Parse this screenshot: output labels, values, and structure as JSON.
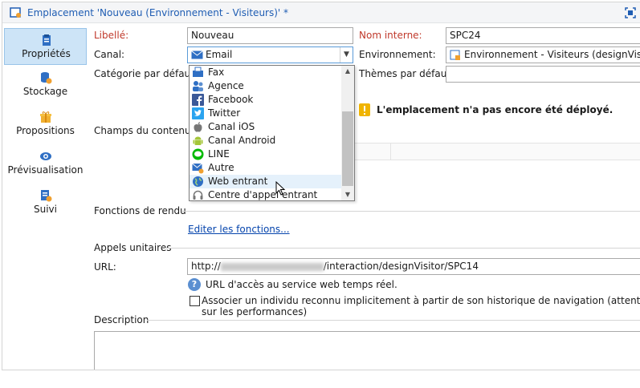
{
  "window": {
    "title": "Emplacement 'Nouveau (Environnement - Visiteurs)' *"
  },
  "sidebar": {
    "items": [
      {
        "label": "Propriétés",
        "icon": "clipboard-icon",
        "active": true
      },
      {
        "label": "Stockage",
        "icon": "database-icon",
        "active": false
      },
      {
        "label": "Propositions",
        "icon": "gift-icon",
        "active": false
      },
      {
        "label": "Prévisualisation",
        "icon": "eye-icon",
        "active": false
      },
      {
        "label": "Suivi",
        "icon": "report-icon",
        "active": false
      }
    ]
  },
  "form": {
    "libelle_label": "Libellé:",
    "libelle_value": "Nouveau",
    "nom_interne_label": "Nom interne:",
    "nom_interne_value": "SPC24",
    "canal_label": "Canal:",
    "canal_value": "Email",
    "environnement_label": "Environnement:",
    "environnement_value": "Environnement - Visiteurs (designVisitor)",
    "categorie_label": "Catégorie par défaut:",
    "themes_label": "Thèmes par défaut:",
    "champs_label": "Champs du contenu d",
    "warning_text": "L'emplacement n'a pas encore été déployé.",
    "fonctions_label": "Fonctions de rendu",
    "editer_link": "Editer les fonctions...",
    "appels_label": "Appels unitaires",
    "url_label": "URL:",
    "url_prefix": "http://",
    "url_suffix": "/interaction/designVisitor/SPC14",
    "url_help": "URL d'accès au service web temps réel.",
    "associer_line1": "Associer un individu reconnu implicitement à partir de son historique de navigation (attention à l'impact",
    "associer_line2": "sur les performances)",
    "associer_checked": false,
    "description_label": "Description"
  },
  "dropdown": {
    "items": [
      {
        "label": "Fax",
        "icon": "fax-icon"
      },
      {
        "label": "Agence",
        "icon": "people-icon"
      },
      {
        "label": "Facebook",
        "icon": "facebook-icon"
      },
      {
        "label": "Twitter",
        "icon": "twitter-icon"
      },
      {
        "label": "Canal iOS",
        "icon": "apple-icon"
      },
      {
        "label": "Canal Android",
        "icon": "android-icon"
      },
      {
        "label": "LINE",
        "icon": "line-icon"
      },
      {
        "label": "Autre",
        "icon": "other-channel-icon"
      },
      {
        "label": "Web entrant",
        "icon": "globe-icon",
        "hover": true
      },
      {
        "label": "Centre d'appel entrant",
        "icon": "headset-icon"
      }
    ]
  },
  "colors": {
    "title": "#1f5db3",
    "required": "#c0392b",
    "active_nav": "#cde4f7",
    "link": "#0645ad",
    "warning": "#f0b400"
  }
}
